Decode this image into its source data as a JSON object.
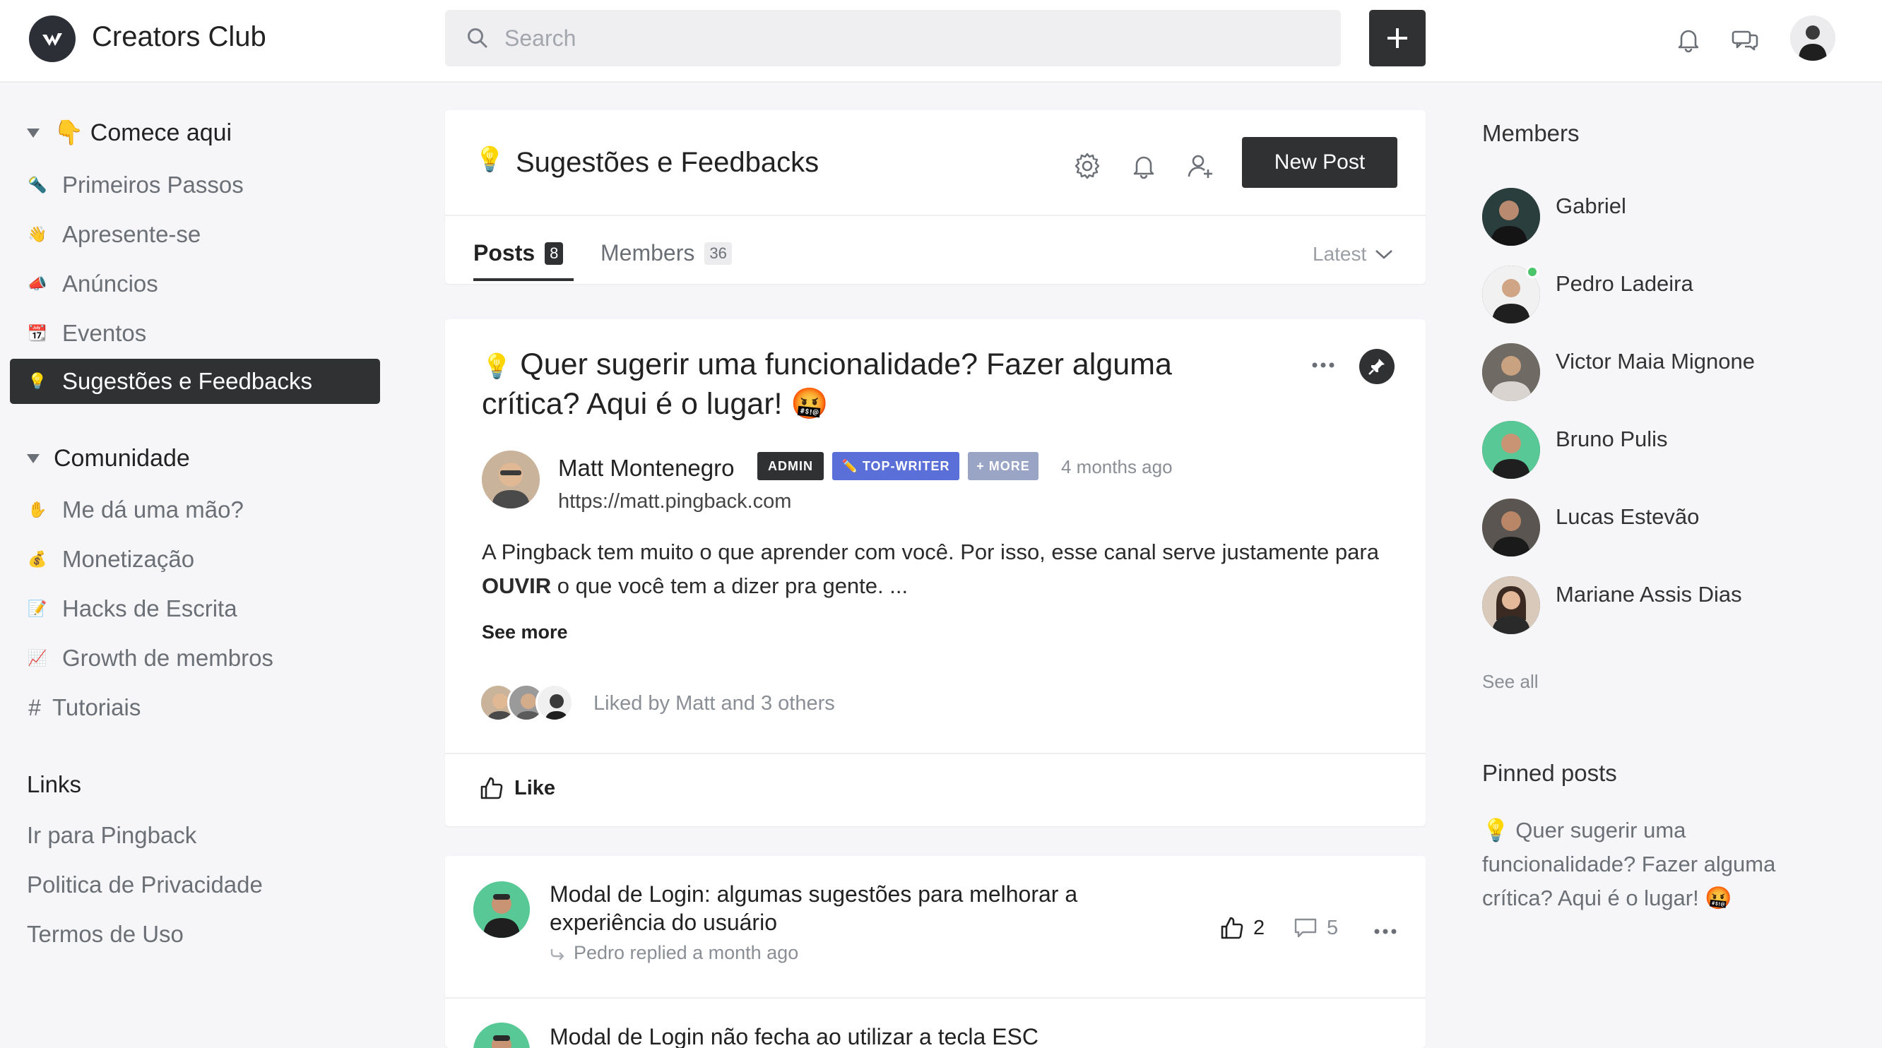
{
  "header": {
    "brand": "Creators Club",
    "search_placeholder": "Search"
  },
  "sidebar": {
    "sections": [
      {
        "title": "👇 Comece aqui",
        "items": [
          {
            "emoji": "🔦",
            "label": "Primeiros Passos"
          },
          {
            "emoji": "👋",
            "label": "Apresente-se"
          },
          {
            "emoji": "📣",
            "label": "Anúncios"
          },
          {
            "emoji": "📆",
            "label": "Eventos"
          },
          {
            "emoji": "💡",
            "label": "Sugestões e Feedbacks",
            "active": true
          }
        ]
      },
      {
        "title": "Comunidade",
        "items": [
          {
            "emoji": "✋",
            "label": "Me dá uma mão?"
          },
          {
            "emoji": "💰",
            "label": "Monetização"
          },
          {
            "emoji": "📝",
            "label": "Hacks de Escrita"
          },
          {
            "emoji": "📈",
            "label": "Growth de membros"
          },
          {
            "emoji": "#",
            "label": "Tutoriais"
          }
        ]
      }
    ],
    "links_title": "Links",
    "links": [
      "Ir para Pingback",
      "Politica de Privacidade",
      "Termos de Uso"
    ]
  },
  "space": {
    "emoji": "💡",
    "title": "Sugestões e Feedbacks",
    "new_post_label": "New Post",
    "tabs": [
      {
        "label": "Posts",
        "count": "8"
      },
      {
        "label": "Members",
        "count": "36"
      }
    ],
    "sort_label": "Latest"
  },
  "featured_post": {
    "emoji": "💡",
    "title": "Quer sugerir uma funcionalidade? Fazer alguma crítica? Aqui é o lugar! 🤬",
    "author": "Matt Montenegro",
    "badges": [
      {
        "label": "ADMIN",
        "color": "#2f3133"
      },
      {
        "label": "✏️ TOP-WRITER",
        "color": "#5a6fd8"
      },
      {
        "label": "+ MORE",
        "color": "#9aa4c4"
      }
    ],
    "time": "4 months ago",
    "url": "https://matt.pingback.com",
    "body_before": "A Pingback tem muito o que aprender com você. Por isso, esse canal serve justamente para ",
    "body_bold": "OUVIR",
    "body_after": " o que você tem a dizer pra gente. ...",
    "see_more": "See more",
    "liked_by": "Liked by Matt and 3 others",
    "like_label": "Like"
  },
  "posts": [
    {
      "title": "Modal de Login: algumas sugestões para melhorar a experiência do usuário",
      "reply": "Pedro replied a month ago",
      "likes": "2",
      "comments": "5"
    },
    {
      "title": "Modal de Login não fecha ao utilizar a tecla ESC"
    }
  ],
  "members_panel": {
    "title": "Members",
    "members": [
      {
        "name": "Gabriel"
      },
      {
        "name": "Pedro Ladeira",
        "online": true
      },
      {
        "name": "Victor Maia Mignone"
      },
      {
        "name": "Bruno Pulis"
      },
      {
        "name": "Lucas Estevão"
      },
      {
        "name": "Mariane Assis Dias"
      }
    ],
    "see_all": "See all"
  },
  "pinned_panel": {
    "title": "Pinned posts",
    "post": "💡 Quer sugerir uma funcionalidade? Fazer alguma crítica? Aqui é o lugar! 🤬"
  },
  "colors": {
    "dark": "#2f3133",
    "muted": "#6b6f76",
    "background": "#f6f6f8",
    "online": "#4cc46a"
  }
}
